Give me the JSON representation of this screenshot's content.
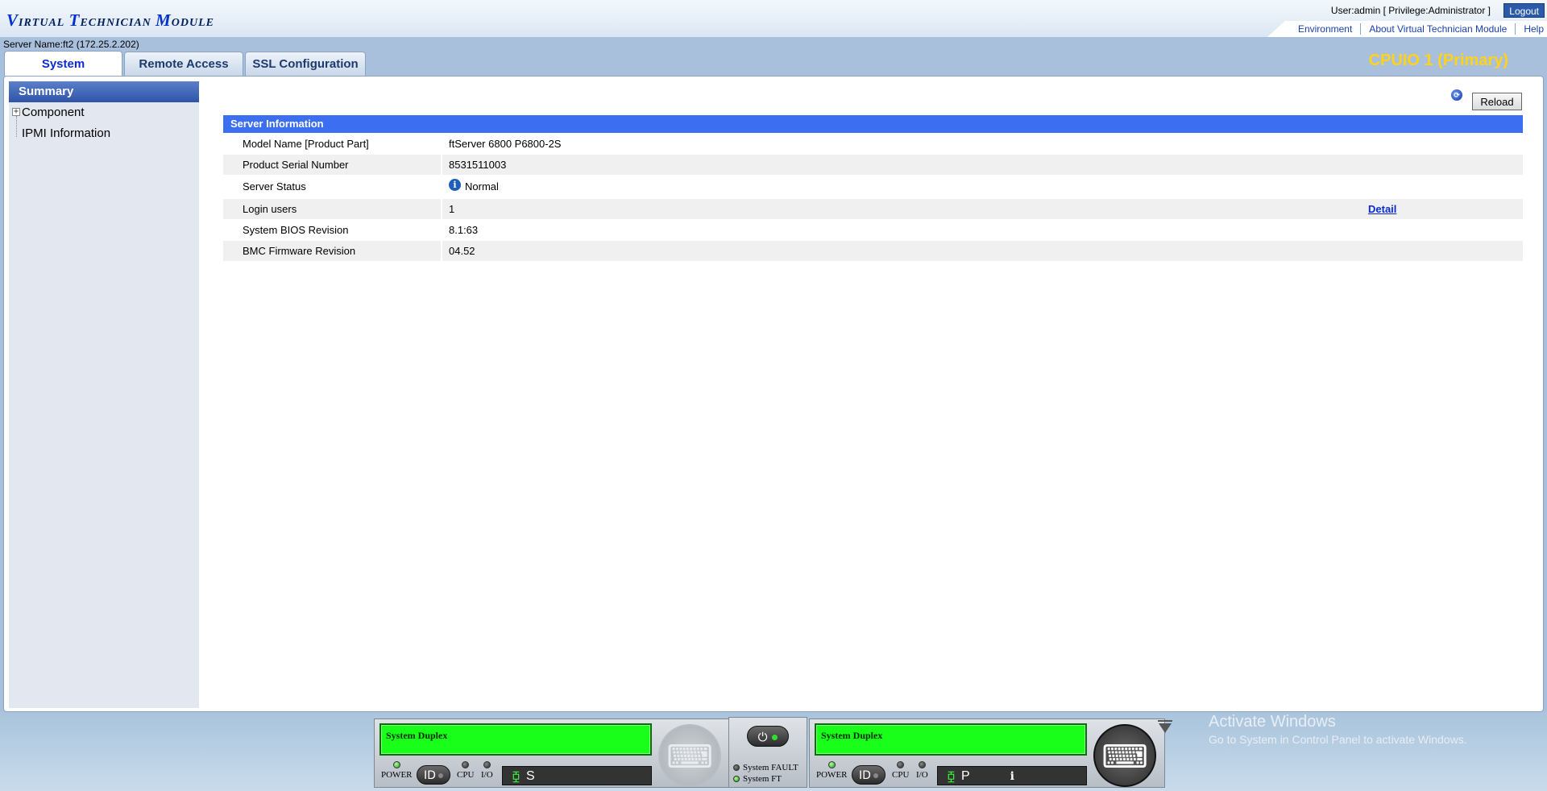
{
  "header": {
    "logo": {
      "v": "V",
      "irtual": "IRTUAL",
      "t": "T",
      "echnician": "ECHNICIAN",
      "m": "M",
      "odule": "ODULE"
    },
    "user_line": "User:admin [ Privilege:Administrator ]",
    "logout_label": "Logout",
    "links": [
      "Environment",
      "About Virtual Technician Module",
      "Help"
    ]
  },
  "band": {
    "server_name": "Server Name:ft2 (172.25.2.202)",
    "tabs": [
      "System",
      "Remote Access",
      "SSL Configuration"
    ],
    "active_tab": "System",
    "cpuio_label": "CPUIO 1 (Primary)"
  },
  "sidebar": {
    "summary": "Summary",
    "items": [
      "Component",
      "IPMI Information"
    ]
  },
  "content": {
    "reload_label": "Reload",
    "panel_title": "Server Information",
    "rows": [
      {
        "label": "Model Name [Product Part]",
        "value": "ftServer 6800 P6800-2S"
      },
      {
        "label": "Product Serial Number",
        "value": "8531511003"
      },
      {
        "label": "Server Status",
        "value": "Normal"
      },
      {
        "label": "Login users",
        "value": "1",
        "link": "Detail"
      },
      {
        "label": "System BIOS Revision",
        "value": "8.1:63"
      },
      {
        "label": "BMC Firmware Revision",
        "value": "04.52"
      }
    ]
  },
  "status_bar": {
    "left_module": {
      "lcd": "System Duplex",
      "power": "POWER",
      "id": "ID",
      "cpu": "CPU",
      "io": "I/O",
      "state": "S"
    },
    "right_module": {
      "lcd": "System Duplex",
      "power": "POWER",
      "id": "ID",
      "cpu": "CPU",
      "io": "I/O",
      "state": "P"
    },
    "center": {
      "fault": "System FAULT",
      "ft": "System FT"
    },
    "watermark": {
      "title": "Activate Windows",
      "subtitle": "Go to System in Control Panel to activate Windows."
    }
  }
}
